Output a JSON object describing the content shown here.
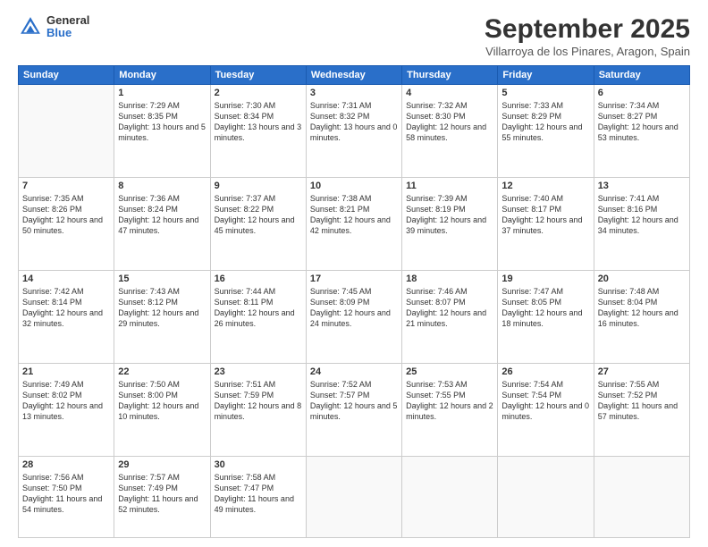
{
  "logo": {
    "general": "General",
    "blue": "Blue"
  },
  "header": {
    "month": "September 2025",
    "location": "Villarroya de los Pinares, Aragon, Spain"
  },
  "weekdays": [
    "Sunday",
    "Monday",
    "Tuesday",
    "Wednesday",
    "Thursday",
    "Friday",
    "Saturday"
  ],
  "weeks": [
    [
      {
        "day": "",
        "sunrise": "",
        "sunset": "",
        "daylight": ""
      },
      {
        "day": "1",
        "sunrise": "Sunrise: 7:29 AM",
        "sunset": "Sunset: 8:35 PM",
        "daylight": "Daylight: 13 hours and 5 minutes."
      },
      {
        "day": "2",
        "sunrise": "Sunrise: 7:30 AM",
        "sunset": "Sunset: 8:34 PM",
        "daylight": "Daylight: 13 hours and 3 minutes."
      },
      {
        "day": "3",
        "sunrise": "Sunrise: 7:31 AM",
        "sunset": "Sunset: 8:32 PM",
        "daylight": "Daylight: 13 hours and 0 minutes."
      },
      {
        "day": "4",
        "sunrise": "Sunrise: 7:32 AM",
        "sunset": "Sunset: 8:30 PM",
        "daylight": "Daylight: 12 hours and 58 minutes."
      },
      {
        "day": "5",
        "sunrise": "Sunrise: 7:33 AM",
        "sunset": "Sunset: 8:29 PM",
        "daylight": "Daylight: 12 hours and 55 minutes."
      },
      {
        "day": "6",
        "sunrise": "Sunrise: 7:34 AM",
        "sunset": "Sunset: 8:27 PM",
        "daylight": "Daylight: 12 hours and 53 minutes."
      }
    ],
    [
      {
        "day": "7",
        "sunrise": "Sunrise: 7:35 AM",
        "sunset": "Sunset: 8:26 PM",
        "daylight": "Daylight: 12 hours and 50 minutes."
      },
      {
        "day": "8",
        "sunrise": "Sunrise: 7:36 AM",
        "sunset": "Sunset: 8:24 PM",
        "daylight": "Daylight: 12 hours and 47 minutes."
      },
      {
        "day": "9",
        "sunrise": "Sunrise: 7:37 AM",
        "sunset": "Sunset: 8:22 PM",
        "daylight": "Daylight: 12 hours and 45 minutes."
      },
      {
        "day": "10",
        "sunrise": "Sunrise: 7:38 AM",
        "sunset": "Sunset: 8:21 PM",
        "daylight": "Daylight: 12 hours and 42 minutes."
      },
      {
        "day": "11",
        "sunrise": "Sunrise: 7:39 AM",
        "sunset": "Sunset: 8:19 PM",
        "daylight": "Daylight: 12 hours and 39 minutes."
      },
      {
        "day": "12",
        "sunrise": "Sunrise: 7:40 AM",
        "sunset": "Sunset: 8:17 PM",
        "daylight": "Daylight: 12 hours and 37 minutes."
      },
      {
        "day": "13",
        "sunrise": "Sunrise: 7:41 AM",
        "sunset": "Sunset: 8:16 PM",
        "daylight": "Daylight: 12 hours and 34 minutes."
      }
    ],
    [
      {
        "day": "14",
        "sunrise": "Sunrise: 7:42 AM",
        "sunset": "Sunset: 8:14 PM",
        "daylight": "Daylight: 12 hours and 32 minutes."
      },
      {
        "day": "15",
        "sunrise": "Sunrise: 7:43 AM",
        "sunset": "Sunset: 8:12 PM",
        "daylight": "Daylight: 12 hours and 29 minutes."
      },
      {
        "day": "16",
        "sunrise": "Sunrise: 7:44 AM",
        "sunset": "Sunset: 8:11 PM",
        "daylight": "Daylight: 12 hours and 26 minutes."
      },
      {
        "day": "17",
        "sunrise": "Sunrise: 7:45 AM",
        "sunset": "Sunset: 8:09 PM",
        "daylight": "Daylight: 12 hours and 24 minutes."
      },
      {
        "day": "18",
        "sunrise": "Sunrise: 7:46 AM",
        "sunset": "Sunset: 8:07 PM",
        "daylight": "Daylight: 12 hours and 21 minutes."
      },
      {
        "day": "19",
        "sunrise": "Sunrise: 7:47 AM",
        "sunset": "Sunset: 8:05 PM",
        "daylight": "Daylight: 12 hours and 18 minutes."
      },
      {
        "day": "20",
        "sunrise": "Sunrise: 7:48 AM",
        "sunset": "Sunset: 8:04 PM",
        "daylight": "Daylight: 12 hours and 16 minutes."
      }
    ],
    [
      {
        "day": "21",
        "sunrise": "Sunrise: 7:49 AM",
        "sunset": "Sunset: 8:02 PM",
        "daylight": "Daylight: 12 hours and 13 minutes."
      },
      {
        "day": "22",
        "sunrise": "Sunrise: 7:50 AM",
        "sunset": "Sunset: 8:00 PM",
        "daylight": "Daylight: 12 hours and 10 minutes."
      },
      {
        "day": "23",
        "sunrise": "Sunrise: 7:51 AM",
        "sunset": "Sunset: 7:59 PM",
        "daylight": "Daylight: 12 hours and 8 minutes."
      },
      {
        "day": "24",
        "sunrise": "Sunrise: 7:52 AM",
        "sunset": "Sunset: 7:57 PM",
        "daylight": "Daylight: 12 hours and 5 minutes."
      },
      {
        "day": "25",
        "sunrise": "Sunrise: 7:53 AM",
        "sunset": "Sunset: 7:55 PM",
        "daylight": "Daylight: 12 hours and 2 minutes."
      },
      {
        "day": "26",
        "sunrise": "Sunrise: 7:54 AM",
        "sunset": "Sunset: 7:54 PM",
        "daylight": "Daylight: 12 hours and 0 minutes."
      },
      {
        "day": "27",
        "sunrise": "Sunrise: 7:55 AM",
        "sunset": "Sunset: 7:52 PM",
        "daylight": "Daylight: 11 hours and 57 minutes."
      }
    ],
    [
      {
        "day": "28",
        "sunrise": "Sunrise: 7:56 AM",
        "sunset": "Sunset: 7:50 PM",
        "daylight": "Daylight: 11 hours and 54 minutes."
      },
      {
        "day": "29",
        "sunrise": "Sunrise: 7:57 AM",
        "sunset": "Sunset: 7:49 PM",
        "daylight": "Daylight: 11 hours and 52 minutes."
      },
      {
        "day": "30",
        "sunrise": "Sunrise: 7:58 AM",
        "sunset": "Sunset: 7:47 PM",
        "daylight": "Daylight: 11 hours and 49 minutes."
      },
      {
        "day": "",
        "sunrise": "",
        "sunset": "",
        "daylight": ""
      },
      {
        "day": "",
        "sunrise": "",
        "sunset": "",
        "daylight": ""
      },
      {
        "day": "",
        "sunrise": "",
        "sunset": "",
        "daylight": ""
      },
      {
        "day": "",
        "sunrise": "",
        "sunset": "",
        "daylight": ""
      }
    ]
  ]
}
